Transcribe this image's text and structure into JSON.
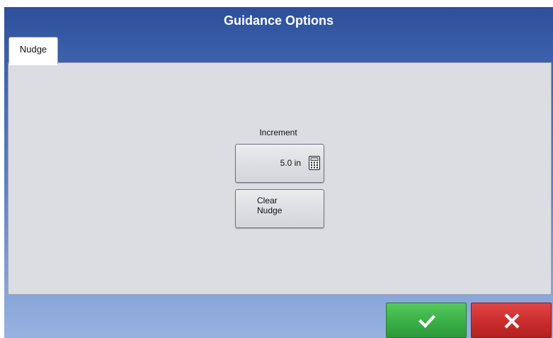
{
  "window": {
    "title": "Guidance Options"
  },
  "tabs": [
    {
      "label": "Nudge",
      "active": true
    }
  ],
  "nudge": {
    "increment_label": "Increment",
    "increment_value": "5.0 in",
    "clear_label_line1": "Clear",
    "clear_label_line2": "Nudge"
  },
  "footer": {
    "confirm_icon": "checkmark-icon",
    "cancel_icon": "close-icon"
  },
  "colors": {
    "title_bar": "#3e63ae",
    "panel": "#dcdde3",
    "confirm": "#3cb14a",
    "cancel": "#cc2e2e"
  }
}
